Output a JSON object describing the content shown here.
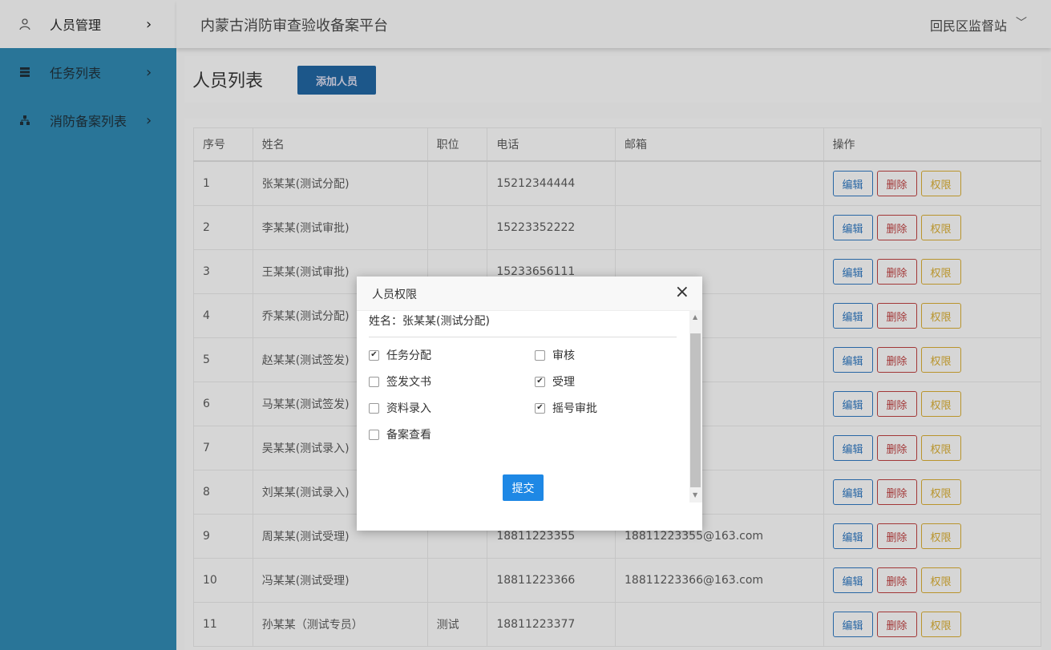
{
  "sidebar": {
    "items": [
      {
        "label": "人员管理",
        "icon": "person-icon",
        "active": true
      },
      {
        "label": "任务列表",
        "icon": "list-icon",
        "active": false
      },
      {
        "label": "消防备案列表",
        "icon": "sitemap-icon",
        "active": false
      }
    ]
  },
  "header": {
    "title": "内蒙古消防审查验收备案平台",
    "station": "回民区监督站"
  },
  "page": {
    "title": "人员列表",
    "add_button": "添加人员"
  },
  "table": {
    "columns": [
      "序号",
      "姓名",
      "职位",
      "电话",
      "邮箱",
      "操作"
    ],
    "actions": {
      "edit": "编辑",
      "delete": "删除",
      "permission": "权限"
    },
    "rows": [
      {
        "no": "1",
        "name": "张某某(测试分配)",
        "position": "",
        "phone": "15212344444",
        "email": ""
      },
      {
        "no": "2",
        "name": "李某某(测试审批)",
        "position": "",
        "phone": "15223352222",
        "email": ""
      },
      {
        "no": "3",
        "name": "王某某(测试审批)",
        "position": "",
        "phone": "15233656111",
        "email": ""
      },
      {
        "no": "4",
        "name": "乔某某(测试分配)",
        "position": "",
        "phone": "",
        "email": ""
      },
      {
        "no": "5",
        "name": "赵某某(测试签发)",
        "position": "",
        "phone": "",
        "email": ""
      },
      {
        "no": "6",
        "name": "马某某(测试签发)",
        "position": "",
        "phone": "",
        "email": ""
      },
      {
        "no": "7",
        "name": "吴某某(测试录入)",
        "position": "",
        "phone": "",
        "email": ".com"
      },
      {
        "no": "8",
        "name": "刘某某(测试录入)",
        "position": "",
        "phone": "",
        "email": "63.com"
      },
      {
        "no": "9",
        "name": "周某某(测试受理)",
        "position": "",
        "phone": "18811223355",
        "email": "18811223355@163.com"
      },
      {
        "no": "10",
        "name": "冯某某(测试受理)",
        "position": "",
        "phone": "18811223366",
        "email": "18811223366@163.com"
      },
      {
        "no": "11",
        "name": "孙某某（测试专员）",
        "position": "测试",
        "phone": "18811223377",
        "email": ""
      }
    ]
  },
  "modal": {
    "title": "人员权限",
    "close": "×",
    "name_line": "姓名：张某某(测试分配)",
    "permissions": [
      {
        "label": "任务分配",
        "checked": true
      },
      {
        "label": "审核",
        "checked": false
      },
      {
        "label": "签发文书",
        "checked": false
      },
      {
        "label": "受理",
        "checked": true
      },
      {
        "label": "资料录入",
        "checked": false
      },
      {
        "label": "摇号审批",
        "checked": true
      },
      {
        "label": "备案查看",
        "checked": false
      }
    ],
    "submit": "提交"
  }
}
